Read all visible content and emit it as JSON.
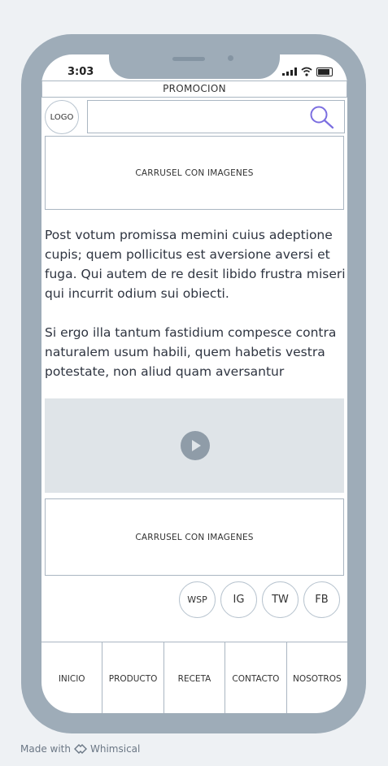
{
  "status_bar": {
    "time": "3:03"
  },
  "header": {
    "title": "PROMOCION"
  },
  "logo": {
    "label": "LOGO"
  },
  "search": {
    "placeholder": "",
    "icon": "search-icon"
  },
  "carousel_top": {
    "label": "CARRUSEL CON IMAGENES"
  },
  "content": {
    "paragraph_1": "Post votum promissa memini cuius adeptione cupis; quem pollicitus est aversione aversi et fuga. Qui autem de re desit libido frustra miseri qui incurrit odium sui obiecti.",
    "paragraph_2": "Si ergo illa tantum fastidium compesce contra naturalem usum habili, quem habetis vestra potestate, non aliud quam aversantur"
  },
  "video": {
    "icon": "play-icon"
  },
  "carousel_bottom": {
    "label": "CARRUSEL CON IMAGENES"
  },
  "social": [
    "WSP",
    "IG",
    "TW",
    "FB"
  ],
  "nav": [
    "INICIO",
    "PRODUCTO",
    "RECETA",
    "CONTACTO",
    "NOSOTROS"
  ],
  "footer": {
    "text": "Made with",
    "brand": "Whimsical"
  }
}
